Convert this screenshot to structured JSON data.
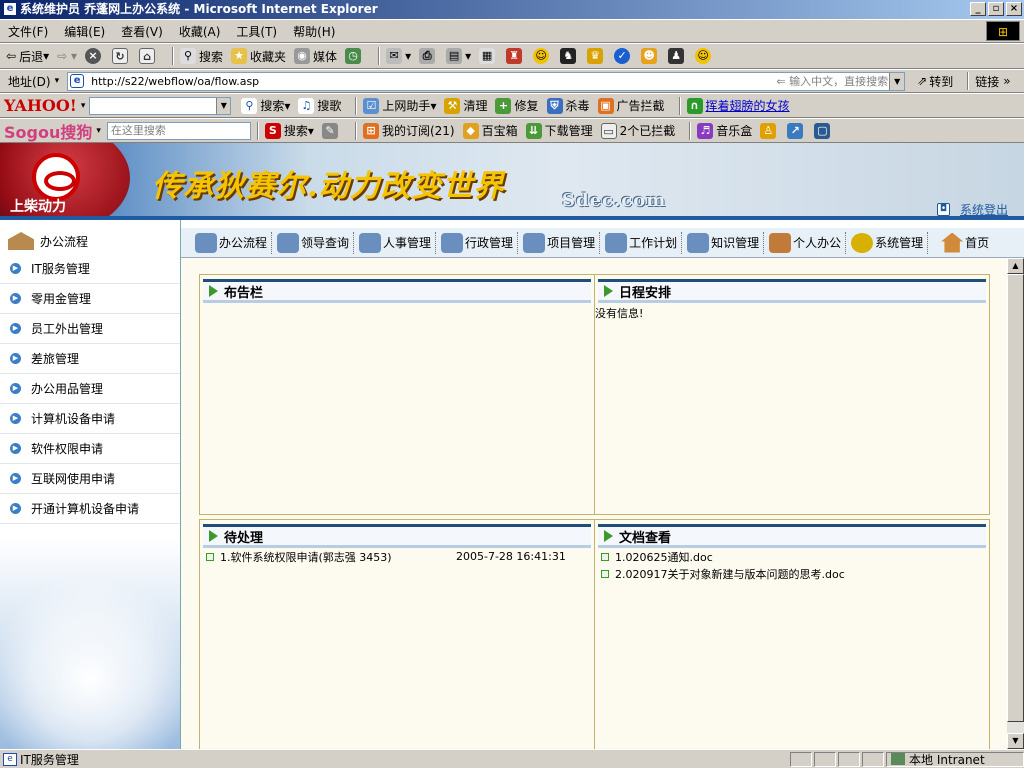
{
  "window": {
    "title": "系统维护员 乔蓬网上办公系统 - Microsoft Internet Explorer"
  },
  "menu": [
    "文件(F)",
    "编辑(E)",
    "查看(V)",
    "收藏(A)",
    "工具(T)",
    "帮助(H)"
  ],
  "toolbar": {
    "back": "后退",
    "search": "搜索",
    "favorites": "收藏夹",
    "media": "媒体"
  },
  "address": {
    "label": "地址(D)",
    "url": "http://s22/webflow/oa/flow.asp",
    "hint": "输入中文，直接搜索",
    "go": "转到",
    "links": "链接"
  },
  "yahoo_bar": {
    "logo": "YAHOO!",
    "search": "搜索",
    "music": "搜歌",
    "assistant": "上网助手",
    "clean": "清理",
    "repair": "修复",
    "antivirus": "杀毒",
    "adblock": "广告拦截",
    "link": "挥着翅膀的女孩"
  },
  "sogou_bar": {
    "logo": "Sogou搜狗",
    "placeholder": "在这里搜索",
    "search": "搜索",
    "subscribe": "我的订阅(21)",
    "box": "百宝箱",
    "download": "下载管理",
    "blocked": "2个已拦截",
    "music": "音乐盒"
  },
  "banner": {
    "company": "上柴动力",
    "slogan": "传承狄赛尔.动力改变世界",
    "site": "Sdec.com",
    "logout": "系统登出"
  },
  "sidebar": {
    "header": "办公流程",
    "items": [
      "IT服务管理",
      "零用金管理",
      "员工外出管理",
      "差旅管理",
      "办公用品管理",
      "计算机设备申请",
      "软件权限申请",
      "互联网使用申请",
      "开通计算机设备申请"
    ]
  },
  "nav": {
    "items": [
      "办公流程",
      "领导查询",
      "人事管理",
      "行政管理",
      "项目管理",
      "工作计划",
      "知识管理",
      "个人办公",
      "系统管理",
      "首页"
    ]
  },
  "panels": {
    "bulletin": {
      "title": "布告栏"
    },
    "schedule": {
      "title": "日程安排",
      "empty": "没有信息!"
    },
    "pending": {
      "title": "待处理",
      "items": [
        {
          "text": "1.软件系统权限申请(郭志强 3453)",
          "time": "2005-7-28 16:41:31"
        }
      ]
    },
    "documents": {
      "title": "文档查看",
      "items": [
        "1.020625通知.doc",
        "2.020917关于对象新建与版本问题的思考.doc"
      ]
    }
  },
  "status": {
    "text": "IT服务管理",
    "zone": "本地 Intranet"
  }
}
